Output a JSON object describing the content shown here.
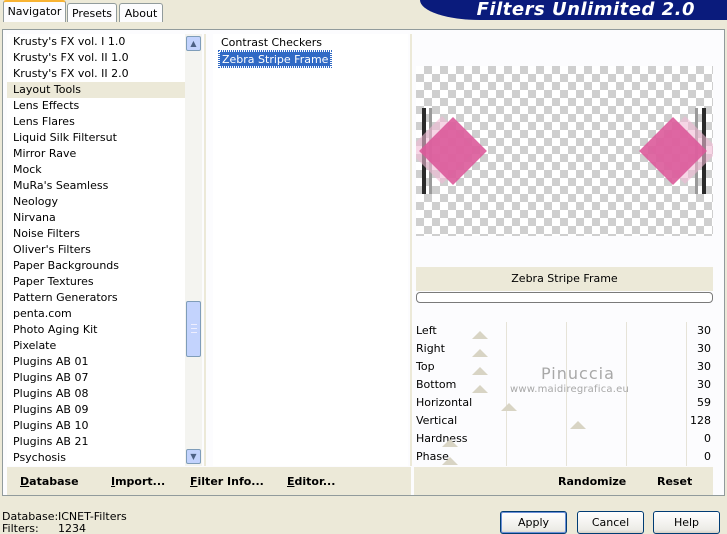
{
  "tabs": [
    {
      "label": "Navigator",
      "active": true
    },
    {
      "label": "Presets",
      "active": false
    },
    {
      "label": "About",
      "active": false
    }
  ],
  "banner": {
    "title": "Filters Unlimited 2.0"
  },
  "categories": {
    "items": [
      "Krusty's FX vol. I 1.0",
      "Krusty's FX vol. II 1.0",
      "Krusty's FX vol. II 2.0",
      "Layout Tools",
      "Lens Effects",
      "Lens Flares",
      "Liquid Silk Filtersut",
      "Mirror Rave",
      "Mock",
      "MuRa's Seamless",
      "Neology",
      "Nirvana",
      "Noise Filters",
      "Oliver's Filters",
      "Paper Backgrounds",
      "Paper Textures",
      "Pattern Generators",
      "penta.com",
      "Photo Aging Kit",
      "Pixelate",
      "Plugins AB 01",
      "Plugins AB 07",
      "Plugins AB 08",
      "Plugins AB 09",
      "Plugins AB 10",
      "Plugins AB 21",
      "Psychosis"
    ],
    "selected_index": 3
  },
  "filters": {
    "items": [
      "Contrast Checkers",
      "Zebra Stripe Frame"
    ],
    "selected_index": 1
  },
  "filter_name": "Zebra Stripe Frame",
  "params": [
    {
      "label": "Left",
      "value": "30",
      "level": 30
    },
    {
      "label": "Right",
      "value": "30",
      "level": 30
    },
    {
      "label": "Top",
      "value": "30",
      "level": 30
    },
    {
      "label": "Bottom",
      "value": "30",
      "level": 30
    },
    {
      "label": "Horizontal",
      "value": "59",
      "level": 59
    },
    {
      "label": "Vertical",
      "value": "128",
      "level": 128
    },
    {
      "label": "Hardness",
      "value": "0",
      "level": 0
    },
    {
      "label": "Phase",
      "value": "0",
      "level": 0
    }
  ],
  "watermark": {
    "line1": "Pinuccia",
    "line2": "www.maidiregrafica.eu"
  },
  "left_buttons": {
    "database": {
      "label": "Database",
      "mnemonic": "D",
      "rest": "atabase"
    },
    "import": {
      "label": "Import...",
      "mnemonic": "I",
      "rest": "mport..."
    },
    "filter_info": {
      "label": "Filter Info...",
      "mnemonic": "F",
      "rest": "ilter Info..."
    },
    "editor": {
      "label": "Editor...",
      "mnemonic": "E",
      "rest": "ditor..."
    }
  },
  "right_buttons": {
    "randomize": "Randomize",
    "reset": "Reset"
  },
  "status": {
    "database_label": "Database:",
    "database_value": "ICNET-Filters",
    "filters_label": "Filters:",
    "filters_value": "1234"
  },
  "dialog_buttons": {
    "apply": "Apply",
    "cancel": "Cancel",
    "help": "Help"
  },
  "colors": {
    "accent": "#0a1b7c",
    "selection": "#316ac5",
    "shape": "#dc5a9a"
  }
}
